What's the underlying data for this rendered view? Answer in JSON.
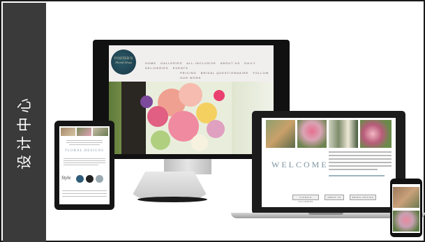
{
  "sidebar": {
    "title": "设计中心"
  },
  "desktop": {
    "logo": {
      "line1": "FOSTER'S",
      "line2": "Floral Shop"
    },
    "nav_row1": [
      "HOME",
      "GALLERIES",
      "ALL-INCLUSIVE",
      "ABOUT US",
      "DAILY DELIVERIES",
      "EVENTS"
    ],
    "nav_row2": [
      "PRICING",
      "BRIDAL QUESTIONNAIRE",
      "FOLLOW OUR WORK"
    ]
  },
  "laptop": {
    "heading": "WELCOME",
    "buttons": [
      "FLORALS GALLERIES",
      "ABOUT US",
      "BRIDAL PRICING"
    ]
  },
  "tablet": {
    "heading": "FLORAL DESIGNS",
    "script_text": "Style"
  },
  "colors": {
    "sidebar_bg": "#3a3a3a",
    "brand_teal": "#1e4150",
    "accent_blue": "#7d95a0"
  }
}
